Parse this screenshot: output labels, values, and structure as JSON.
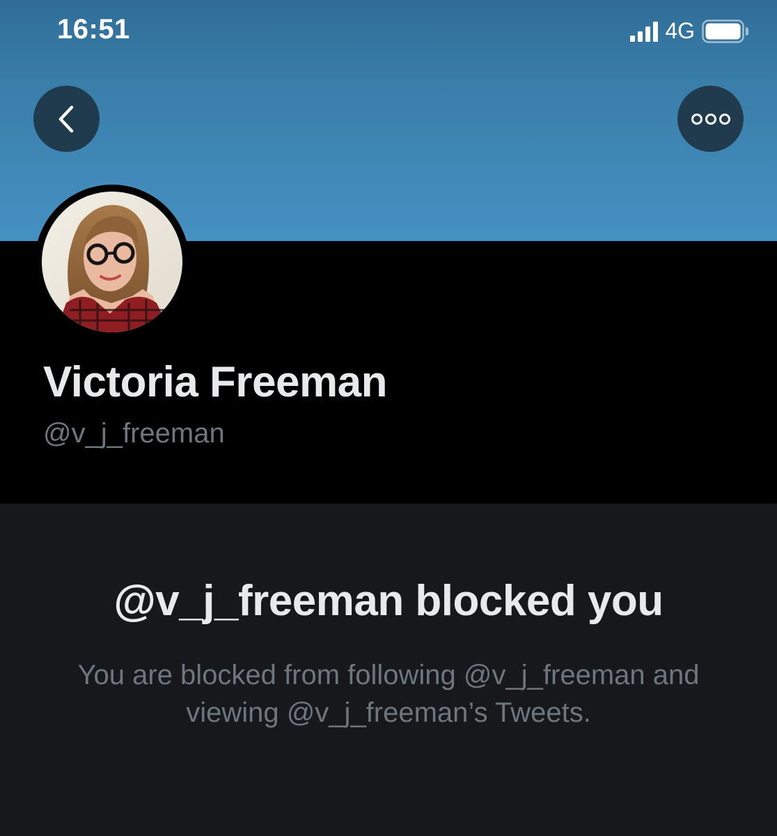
{
  "status_bar": {
    "time": "16:51",
    "network": "4G",
    "icons": [
      "signal-bars-icon",
      "battery-icon"
    ]
  },
  "header": {
    "back_icon": "chevron-left-icon",
    "more_icon": "more-horizontal-icon",
    "banner_color": "#3a7eaa",
    "button_color": "#203a4e"
  },
  "profile": {
    "display_name": "Victoria Freeman",
    "handle": "@v_j_freeman"
  },
  "blocked": {
    "title": "@v_j_freeman blocked you",
    "description": "You are blocked from following @v_j_freeman and viewing @v_j_freeman’s Tweets."
  },
  "colors": {
    "primary_text": "#e7e9ea",
    "secondary_text": "#6e767d",
    "profile_bg": "#000000",
    "blocked_bg": "#16181c"
  }
}
